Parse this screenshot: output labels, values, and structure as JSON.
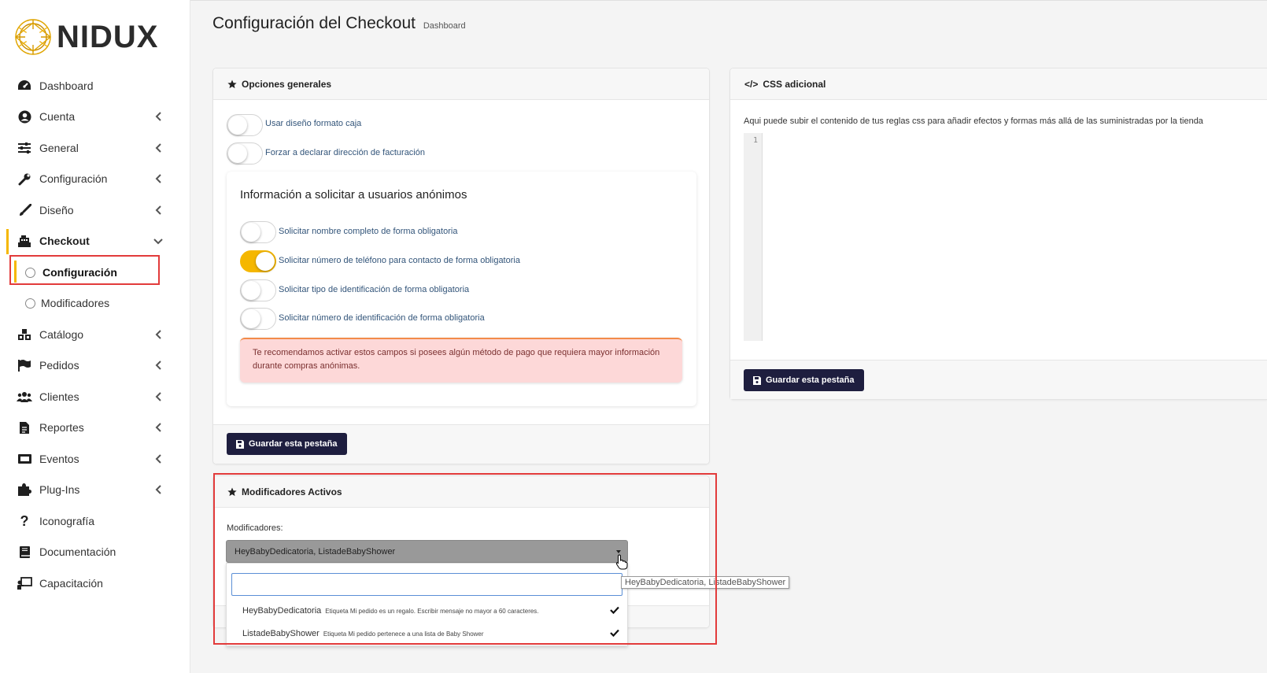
{
  "brand": {
    "name": "NIDUX",
    "accent": "#f5b700",
    "dark": "#1e1e3f",
    "highlight": "#e23b3b"
  },
  "sidebar": {
    "items": [
      {
        "label": "Dashboard",
        "icon": "dashboard-gauge-icon"
      },
      {
        "label": "Cuenta",
        "icon": "user-circle-icon"
      },
      {
        "label": "General",
        "icon": "sliders-icon"
      },
      {
        "label": "Configuración",
        "icon": "wrench-icon"
      },
      {
        "label": "Diseño",
        "icon": "brush-icon"
      },
      {
        "label": "Checkout",
        "icon": "cash-register-icon"
      },
      {
        "label": "Catálogo",
        "icon": "cubes-icon"
      },
      {
        "label": "Pedidos",
        "icon": "flag-icon"
      },
      {
        "label": "Clientes",
        "icon": "users-icon"
      },
      {
        "label": "Reportes",
        "icon": "file-icon"
      },
      {
        "label": "Eventos",
        "icon": "ticket-icon"
      },
      {
        "label": "Plug-Ins",
        "icon": "puzzle-icon"
      },
      {
        "label": "Iconografía",
        "icon": "question-icon"
      },
      {
        "label": "Documentación",
        "icon": "book-icon"
      },
      {
        "label": "Capacitación",
        "icon": "chalkboard-icon"
      }
    ],
    "checkout_sub": [
      {
        "label": "Configuración"
      },
      {
        "label": "Modificadores"
      }
    ]
  },
  "header": {
    "title": "Configuración del Checkout",
    "breadcrumb": "Dashboard"
  },
  "general": {
    "title": "Opciones generales",
    "toggles": [
      {
        "label": "Usar diseño formato caja",
        "on": false
      },
      {
        "label": "Forzar a declarar dirección de facturación",
        "on": false
      }
    ],
    "anon": {
      "title": "Información a solicitar a usuarios anónimos",
      "toggles": [
        {
          "label": "Solicitar nombre completo de forma obligatoria",
          "on": false
        },
        {
          "label": "Solicitar número de teléfono para contacto de forma obligatoria",
          "on": true
        },
        {
          "label": "Solicitar tipo de identificación de forma obligatoria",
          "on": false
        },
        {
          "label": "Solicitar número de identificación de forma obligatoria",
          "on": false
        }
      ],
      "alert": "Te recomendamos activar estos campos si posees algún método de pago que requiera mayor información durante compras anónimas."
    },
    "save_label": "Guardar esta pestaña"
  },
  "css": {
    "title": "CSS adicional",
    "description": "Aqui puede subir el contenido de tus reglas css para añadir efectos y formas más allá de las suministradas por la tienda",
    "line_number": "1",
    "save_label": "Guardar esta pestaña"
  },
  "modifiers": {
    "title": "Modificadores Activos",
    "field_label": "Modificadores:",
    "selected": "HeyBabyDedicatoria, ListadeBabyShower",
    "search_placeholder": "",
    "tooltip": "HeyBabyDedicatoria, ListadeBabyShower",
    "options": [
      {
        "name": "HeyBabyDedicatoria",
        "desc": "Etiqueta Mi pedido es un regalo. Escribir mensaje no mayor a 60 caracteres.",
        "checked": true
      },
      {
        "name": "ListadeBabyShower",
        "desc": "Etiqueta Mi pedido pertenece a una lista de Baby Shower",
        "checked": true
      }
    ]
  }
}
